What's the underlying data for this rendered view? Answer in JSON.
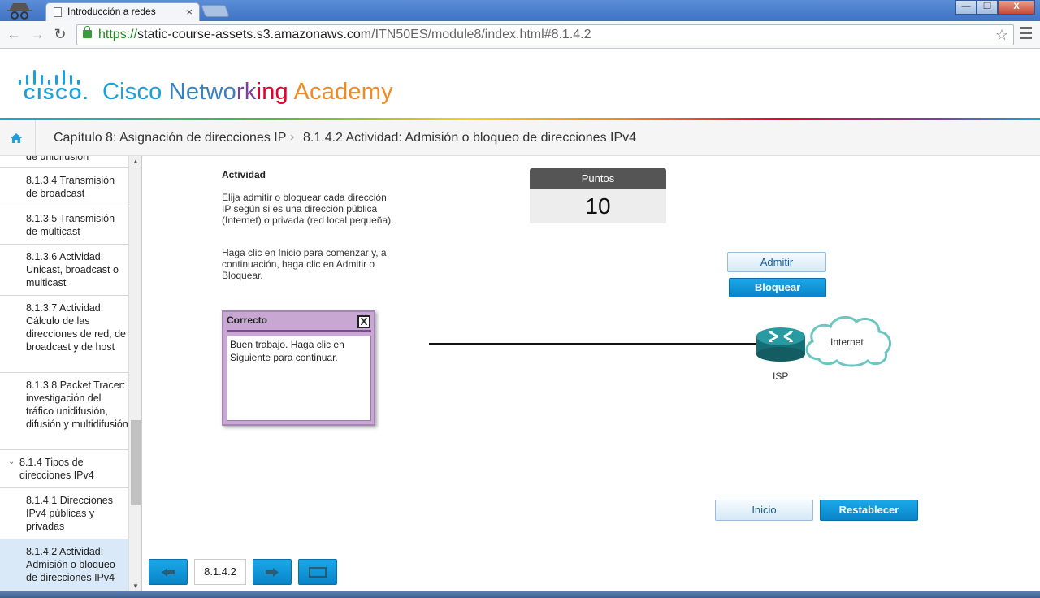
{
  "browser": {
    "tab_title": "Introducción a redes",
    "tab_close": "×",
    "url_scheme": "https://",
    "url_host": "static-course-assets.s3.amazonaws.com",
    "url_path": "/ITN50ES/module8/index.html#8.1.4.2",
    "win_min": "—",
    "win_max": "❐",
    "win_close": "X"
  },
  "brand": {
    "logo_word": "CISCO.",
    "academy_parts": [
      {
        "text": "Cisco ",
        "color": "#1ba0d7"
      },
      {
        "text": "Netwo",
        "color": "#3c7fbf"
      },
      {
        "text": "rk",
        "color": "#7b3f9e"
      },
      {
        "text": "ing",
        "color": "#e4002b"
      },
      {
        "text": " Academy",
        "color": "#f08a24"
      },
      {
        "text": "",
        "color": "#4cb848"
      }
    ]
  },
  "breadcrumb": {
    "chapter": "Capítulo 8: Asignación de direcciones IP",
    "separator": "›",
    "current": "8.1.4.2 Actividad: Admisión o bloqueo de direcciones IPv4"
  },
  "sidebar": {
    "items": [
      {
        "label": "de unidifusión",
        "kind": "item"
      },
      {
        "label": "8.1.3.4 Transmisión de broadcast",
        "kind": "item"
      },
      {
        "label": "8.1.3.5 Transmisión de multicast",
        "kind": "item"
      },
      {
        "label": "8.1.3.6 Actividad: Unicast, broadcast o multicast",
        "kind": "item"
      },
      {
        "label": "8.1.3.7 Actividad: Cálculo de las direcciones de red, de broadcast y de host",
        "kind": "item"
      },
      {
        "label": "8.1.3.8 Packet Tracer: investigación del tráfico unidifusión, difusión y multidifusión",
        "kind": "item"
      },
      {
        "label": "8.1.4 Tipos de direcciones IPv4",
        "kind": "section"
      },
      {
        "label": "8.1.4.1 Direcciones IPv4 públicas y privadas",
        "kind": "item"
      },
      {
        "label": "8.1.4.2 Actividad: Admisión o bloqueo de direcciones IPv4",
        "kind": "active"
      }
    ]
  },
  "activity": {
    "title": "Actividad",
    "instructions_1": "Elija admitir o bloquear cada dirección IP según si es una dirección pública (Internet) o privada (red local pequeña).",
    "instructions_2": "Haga clic en Inicio para comenzar y, a continuación, haga clic en Admitir o Bloquear.",
    "points_label": "Puntos",
    "points_value": "10",
    "allow_label": "Admitir",
    "block_label": "Bloquear",
    "start_label": "Inicio",
    "reset_label": "Restablecer",
    "dialog_title": "Correcto",
    "dialog_close": "X",
    "dialog_body": "Buen trabajo. Haga clic en Siguiente para continuar.",
    "isp_label": "ISP",
    "internet_label": "Internet"
  },
  "nav": {
    "page": "8.1.4.2"
  },
  "colors": {
    "accent_blue": "#0a84c9",
    "dialog_purple": "#c8a8d3",
    "router_teal": "#1b7f86"
  }
}
